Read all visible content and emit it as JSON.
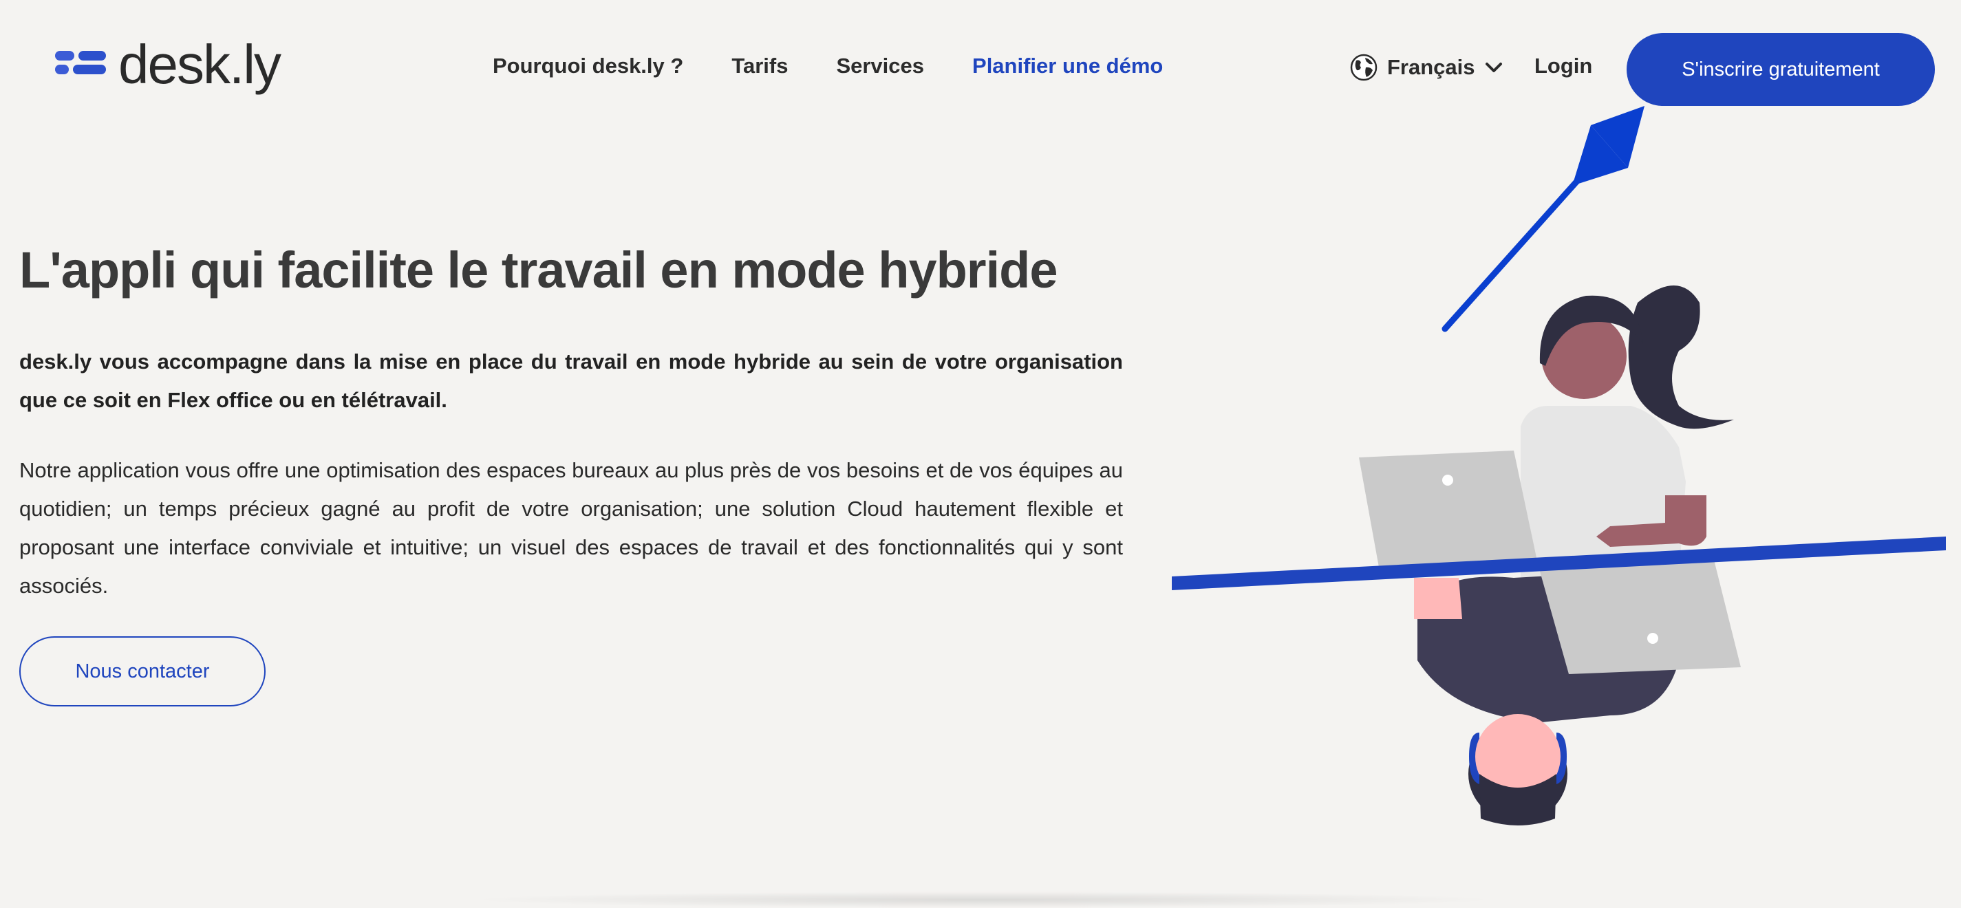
{
  "brand": {
    "name": "desk.ly",
    "accent_color": "#1f45be"
  },
  "nav": {
    "items": [
      {
        "label": "Pourquoi desk.ly ?"
      },
      {
        "label": "Tarifs"
      },
      {
        "label": "Services"
      },
      {
        "label": "Planifier une démo"
      }
    ]
  },
  "header": {
    "language": "Français",
    "language_icon": "globe-icon",
    "login_label": "Login",
    "signup_label": "S'inscrire gratuitement"
  },
  "hero": {
    "title": "L'appli qui facilite le travail en mode hybride",
    "lead": "desk.ly vous accompagne dans la mise en place du travail en mode hybride au sein de votre organisation que ce soit en Flex office ou en télétravail.",
    "body": "Notre application vous offre une optimisation des espaces bureaux au plus près de vos besoins et de vos équipes au quotidien; un temps précieux gagné au profit de votre organisation; une solution Cloud hautement flexible et proposant une interface conviviale et intuitive; un visuel des espaces de travail et des fonctionnalités qui y sont associés.",
    "contact_label": "Nous contacter"
  },
  "illustration": {
    "icon": "woman-with-laptops-illustration"
  }
}
